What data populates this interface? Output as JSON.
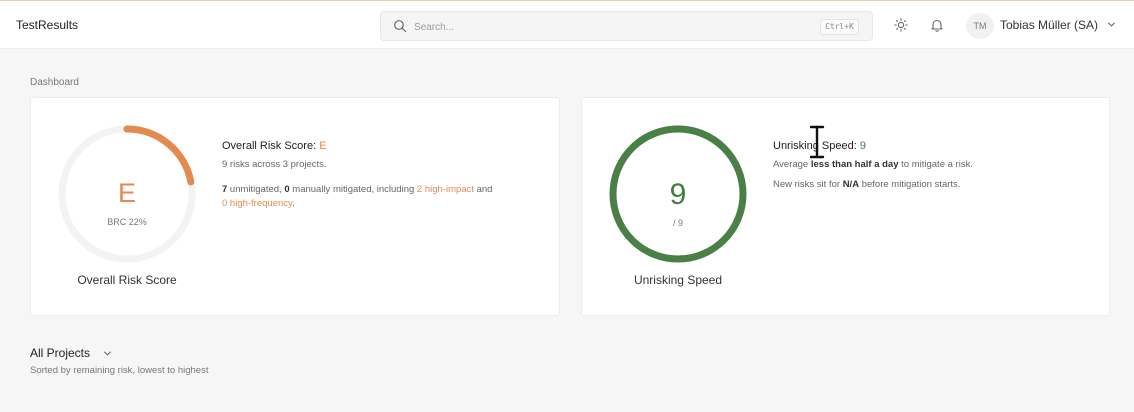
{
  "app": {
    "title": "TestResults"
  },
  "search": {
    "placeholder": "Search...",
    "shortcut": "Ctrl+K"
  },
  "user": {
    "initials": "TM",
    "name": "Tobias Müller (SA)"
  },
  "breadcrumb": "Dashboard",
  "risk_card": {
    "grade": "E",
    "brc": "BRC 22%",
    "caption": "Overall Risk Score",
    "title_prefix": "Overall Risk Score: ",
    "title_value": "E",
    "summary": "9 risks across 3 projects.",
    "unmitigated_count": "7",
    "unmitigated_text": " unmitigated, ",
    "manual_count": "0",
    "manual_text": " manually mitigated, including ",
    "high_impact": "2 high-impact",
    "and_text": " and",
    "high_frequency": "0 high-frequency",
    "period": ".",
    "score_fraction": 0.22,
    "accent_color": "#e38a4e"
  },
  "speed_card": {
    "value": "9",
    "denominator": "/ 9",
    "caption": "Unrisking Speed",
    "title_prefix": "Unrisking Speed: ",
    "title_value": "9",
    "avg_prefix": "Average ",
    "avg_value": "less than half a day",
    "avg_suffix": " to mitigate a risk.",
    "new_prefix": "New risks sit for ",
    "new_value": "N/A",
    "new_suffix": " before mitigation starts.",
    "speed_fraction": 1.0,
    "accent_color": "#4a7f45"
  },
  "projects": {
    "title": "All Projects",
    "subtitle": "Sorted by remaining risk, lowest to highest"
  }
}
